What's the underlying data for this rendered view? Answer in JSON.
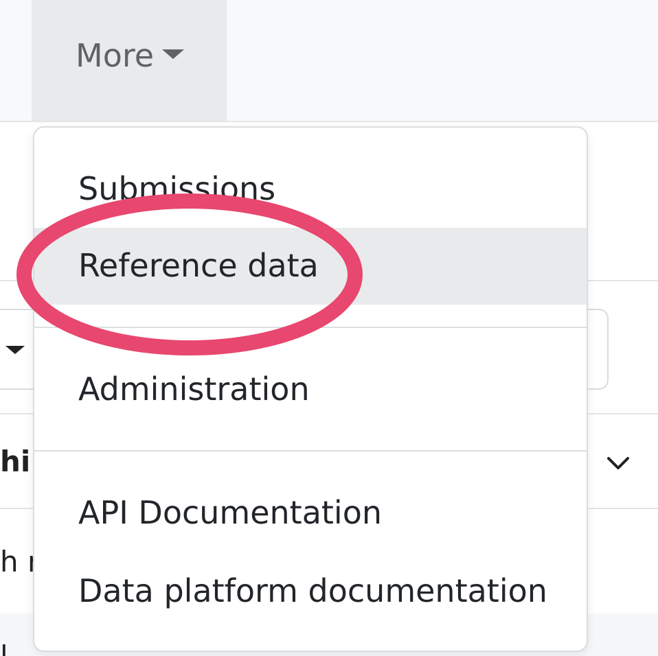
{
  "navbar": {
    "more_label": "More",
    "more_caret_icon": "caret-down-icon"
  },
  "dropdown": {
    "items": [
      {
        "label": "Submissions"
      },
      {
        "label": "Reference data",
        "active": true
      },
      {
        "label": "Administration"
      },
      {
        "label": "API Documentation"
      },
      {
        "label": "Data platform documentation"
      }
    ]
  },
  "background": {
    "row1_text": "hi",
    "row2_text": "h r",
    "row3_text": "l"
  },
  "annotation": {
    "highlight_color": "#e8476f"
  },
  "colors": {
    "navbar_bg": "#f8f9fa",
    "active_bg": "#e9eaec",
    "text": "#222529",
    "muted_text": "#5f6368"
  }
}
